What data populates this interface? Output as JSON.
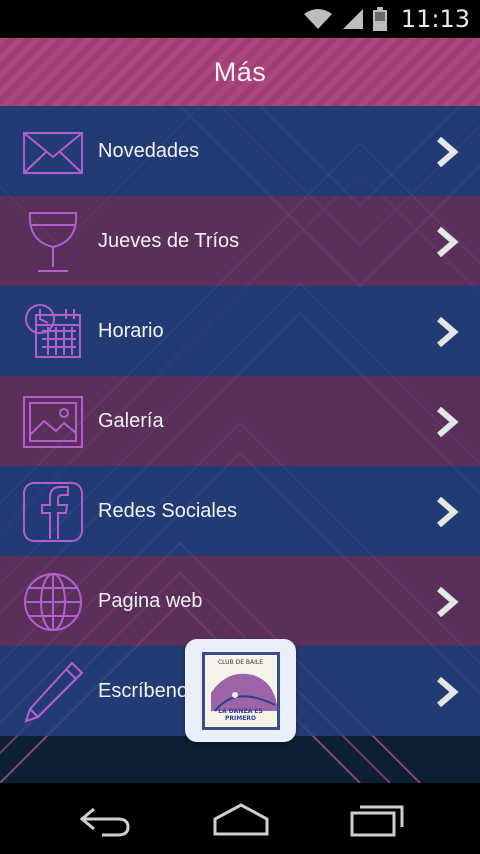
{
  "status_bar": {
    "time": "11:13",
    "icons": [
      "wifi-icon",
      "signal-icon",
      "battery-icon"
    ]
  },
  "header": {
    "title": "Más",
    "color": "#a8407a"
  },
  "menu": {
    "items": [
      {
        "label": "Novedades",
        "icon": "envelope-icon",
        "band": "blue"
      },
      {
        "label": "Jueves de Tríos",
        "icon": "wine-glass-icon",
        "band": "purple"
      },
      {
        "label": "Horario",
        "icon": "calendar-clock-icon",
        "band": "blue"
      },
      {
        "label": "Galería",
        "icon": "picture-icon",
        "band": "purple"
      },
      {
        "label": "Redes Sociales",
        "icon": "facebook-icon",
        "band": "blue"
      },
      {
        "label": "Pagina web",
        "icon": "globe-icon",
        "band": "purple"
      },
      {
        "label": "Escríbenos",
        "icon": "pencil-icon",
        "band": "blue"
      }
    ]
  },
  "badge": {
    "top_text": "CLUB DE BAILE",
    "bottom_text": "LA DANZA ES PRIMERO"
  },
  "colors": {
    "icon_stroke": "#b45fd0",
    "band_blue": "#284282",
    "band_purple": "#6e3464",
    "chevron": "#e6e6e6"
  },
  "nav_bar": {
    "buttons": [
      "back-icon",
      "home-icon",
      "recents-icon"
    ]
  }
}
